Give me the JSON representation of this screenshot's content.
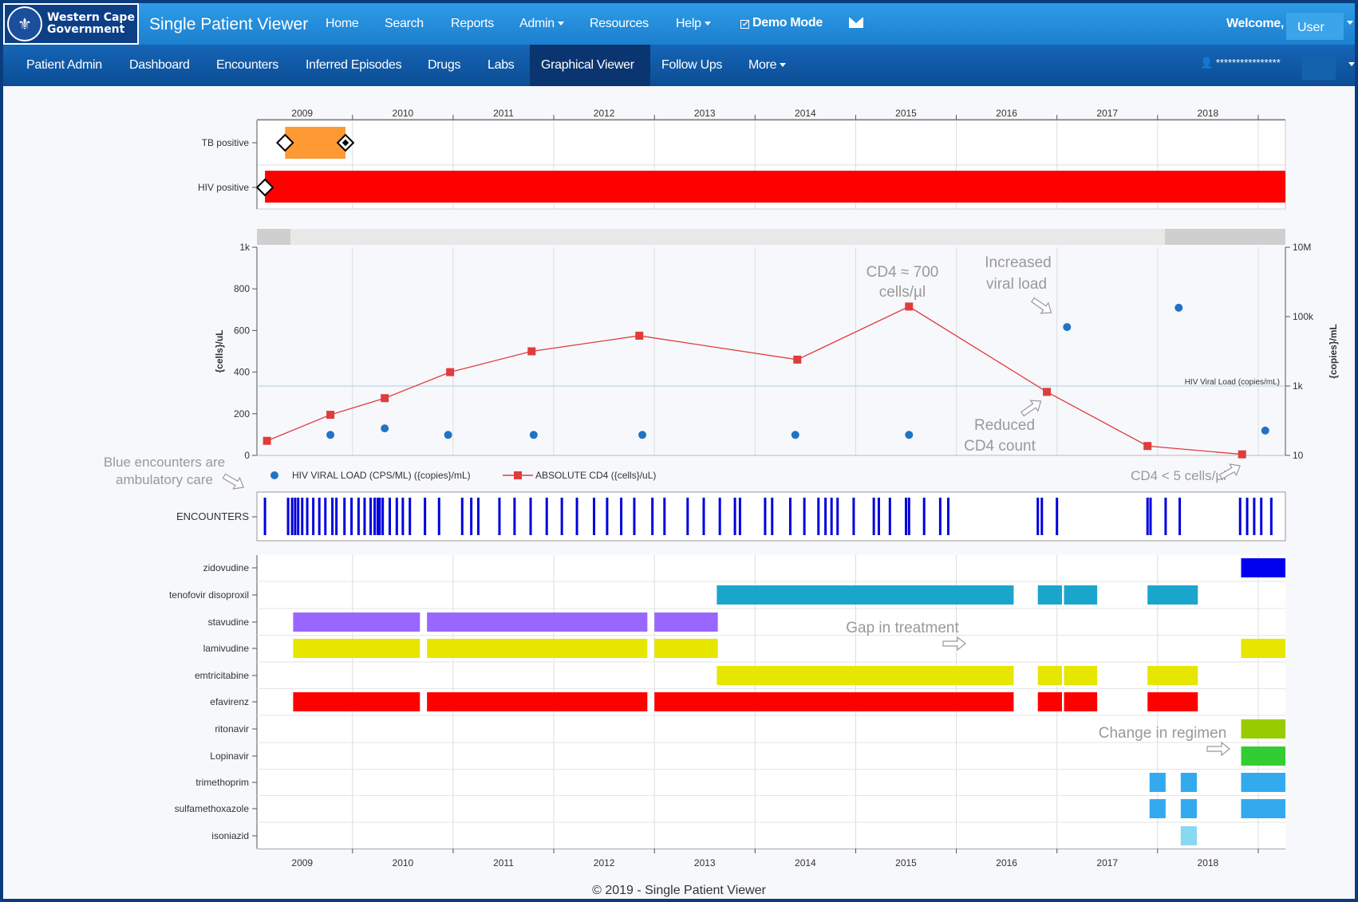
{
  "app": {
    "logo_line1": "Western Cape",
    "logo_line2": "Government",
    "title": "Single Patient Viewer"
  },
  "topnav": {
    "home": "Home",
    "search": "Search",
    "reports": "Reports",
    "admin": "Admin",
    "resources": "Resources",
    "help": "Help",
    "demo_mode": "Demo Mode",
    "welcome": "Welcome,",
    "user": "User"
  },
  "subnav": {
    "patient_admin": "Patient Admin",
    "dashboard": "Dashboard",
    "encounters": "Encounters",
    "inferred_episodes": "Inferred Episodes",
    "drugs": "Drugs",
    "labs": "Labs",
    "graphical_viewer": "Graphical Viewer",
    "follow_ups": "Follow Ups",
    "more": "More",
    "account_masked": "****************"
  },
  "colors": {
    "top_blue": "#2a90dc",
    "nav_blue": "#0f57a3",
    "tb": "#ff9933",
    "hiv": "#ff0000",
    "cd4": "#e03c3c",
    "viral": "#2173c4",
    "encounter": "#0000dd"
  },
  "years": [
    "2009",
    "2010",
    "2011",
    "2012",
    "2013",
    "2014",
    "2015",
    "2016",
    "2017",
    "2018"
  ],
  "episodes": {
    "rows": [
      "TB positive",
      "HIV positive"
    ]
  },
  "chart_data": {
    "type": "line",
    "x_range": [
      2008.55,
      2018.77
    ],
    "left_axis": {
      "label": "{cells}/uL",
      "ticks": [
        "0",
        "200",
        "400",
        "600",
        "800",
        "1k"
      ],
      "ylim": [
        0,
        1000
      ]
    },
    "right_axis": {
      "label": "{copies}/mL",
      "scale": "log",
      "ticks": [
        "10",
        "1k",
        "100k",
        "10M"
      ],
      "ylim": [
        10,
        10000000
      ]
    },
    "threshold_label": "HIV Viral Load (copies/mL)",
    "threshold_value": 1000,
    "series": [
      {
        "name": "ABSOLUTE CD4 ({cells}/uL)",
        "marker": "square",
        "color": "#e03c3c",
        "x": [
          2008.65,
          2009.28,
          2009.82,
          2010.47,
          2011.28,
          2012.35,
          2013.92,
          2015.03,
          2016.4,
          2017.4,
          2018.34
        ],
        "y": [
          70,
          195,
          275,
          400,
          500,
          575,
          460,
          715,
          305,
          45,
          5
        ]
      },
      {
        "name": "HIV VIRAL LOAD (CPS/ML) ({copies}/mL)",
        "marker": "circle",
        "color": "#2173c4",
        "x": [
          2009.28,
          2009.82,
          2010.45,
          2011.3,
          2012.38,
          2013.9,
          2015.03,
          2016.6,
          2017.71,
          2018.57
        ],
        "y": [
          39,
          60,
          39,
          39,
          39,
          39,
          39,
          50000,
          180000,
          52
        ]
      }
    ],
    "annotations": {
      "cd4_peak": [
        "CD4 ≈ 700",
        "cells/µl"
      ],
      "increased": [
        "Increased",
        "viral load"
      ],
      "reduced": [
        "Reduced",
        "CD4 count"
      ],
      "cd4_low": "CD4 < 5 cells/µl",
      "ambulatory": [
        "Blue encounters are",
        "ambulatory care"
      ]
    }
  },
  "encounters": {
    "label": "ENCOUNTERS",
    "dates": [
      2008.63,
      2008.86,
      2008.9,
      2008.93,
      2008.96,
      2009.0,
      2009.05,
      2009.11,
      2009.17,
      2009.23,
      2009.3,
      2009.34,
      2009.42,
      2009.49,
      2009.56,
      2009.62,
      2009.68,
      2009.72,
      2009.75,
      2009.77,
      2009.8,
      2009.87,
      2009.94,
      2010.0,
      2010.07,
      2010.22,
      2010.36,
      2010.59,
      2010.68,
      2010.75,
      2010.96,
      2011.11,
      2011.27,
      2011.43,
      2011.58,
      2011.73,
      2011.9,
      2012.03,
      2012.17,
      2012.3,
      2012.48,
      2012.6,
      2012.83,
      2012.99,
      2013.15,
      2013.3,
      2013.35,
      2013.6,
      2013.67,
      2013.85,
      2013.99,
      2014.13,
      2014.2,
      2014.26,
      2014.32,
      2014.48,
      2014.68,
      2014.73,
      2014.84,
      2015.0,
      2015.03,
      2015.18,
      2015.34,
      2015.42,
      2016.31,
      2016.35,
      2016.5,
      2017.4,
      2017.43,
      2017.58,
      2017.72,
      2018.32,
      2018.39,
      2018.46,
      2018.53,
      2018.63
    ]
  },
  "drugs": {
    "names": [
      "zidovudine",
      "tenofovir disoproxil",
      "stavudine",
      "lamivudine",
      "emtricitabine",
      "efavirenz",
      "ritonavir",
      "Lopinavir",
      "trimethoprim",
      "sulfamethoxazole",
      "isoniazid"
    ],
    "annotations": {
      "gap": "Gap in treatment",
      "change": "Change in regimen"
    }
  },
  "footer": "© 2019 - Single Patient Viewer"
}
